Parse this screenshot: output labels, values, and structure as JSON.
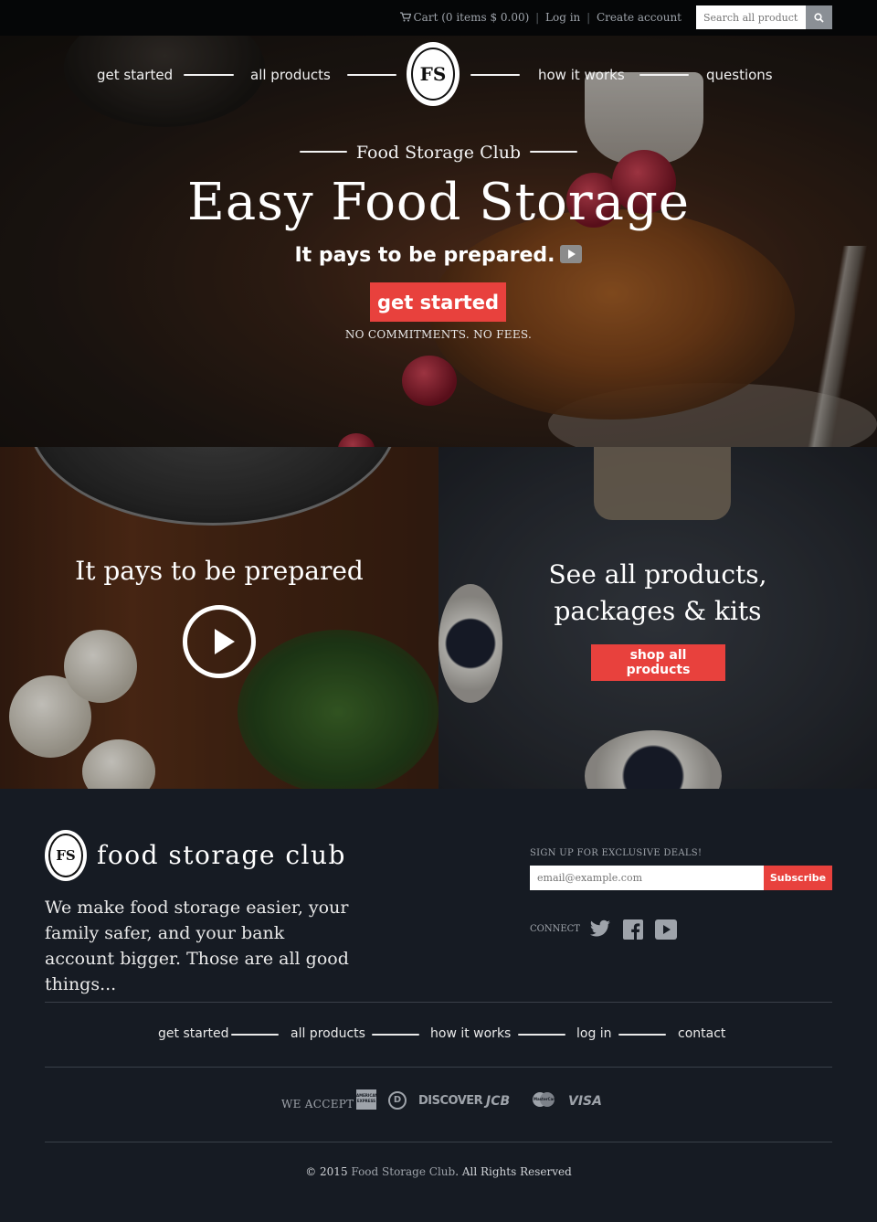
{
  "topbar": {
    "cart_label": "Cart (0 items $ 0.00)",
    "login_label": "Log in",
    "separator": "|",
    "create_account_label": "Create account",
    "search_placeholder": "Search all products"
  },
  "nav": {
    "get_started": "get started",
    "all_products": "all products",
    "how_it_works": "how it works",
    "questions": "questions",
    "logo_text": "FS"
  },
  "hero": {
    "brand_line": "Food Storage Club",
    "title": "Easy Food Storage",
    "subtitle": "It pays to be prepared.",
    "cta_label": "get started",
    "note": "NO COMMITMENTS. NO FEES."
  },
  "panels": {
    "left_title": "It pays to be prepared",
    "right_title": "See all products, packages & kits",
    "shop_button": "shop all products"
  },
  "footer": {
    "brand": "food storage club",
    "tagline": "We make food storage easier, your family safer, and your bank account bigger. Those are all good things...",
    "signup_label": "SIGN UP FOR EXCLUSIVE DEALS!",
    "email_placeholder": "email@example.com",
    "subscribe_label": "Subscribe",
    "connect_label": "CONNECT",
    "nav": {
      "get_started": "get started",
      "all_products": "all products",
      "how_it_works": "how it works",
      "log_in": "log in",
      "contact": "contact"
    },
    "we_accept": "WE ACCEPT",
    "cards": {
      "amex": "AMERICAN EXPRESS",
      "diners": "D",
      "discover": "DISCOVER",
      "jcb": "JCB",
      "mastercard": "MasterCard",
      "visa": "VISA"
    },
    "copyright_prefix": "© 2015",
    "copyright_link": "Food Storage Club",
    "copyright_suffix": ". All Rights Reserved"
  },
  "colors": {
    "accent": "#e8413d",
    "footer_bg": "#161b23",
    "topbar_bg": "#050607"
  },
  "icons": [
    "cart-icon",
    "search-icon",
    "play-icon",
    "twitter-icon",
    "facebook-icon",
    "youtube-icon"
  ]
}
